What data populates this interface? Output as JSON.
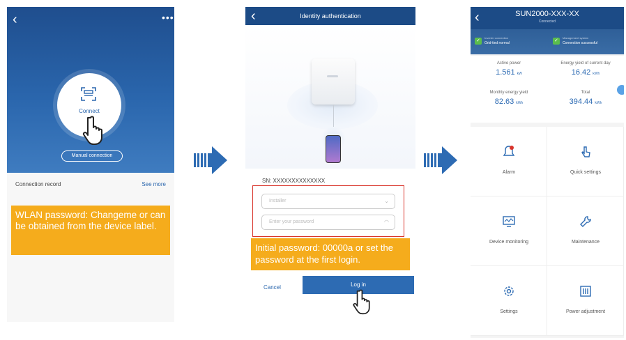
{
  "screen1": {
    "connect_label": "Connect",
    "manual_connection": "Manual connection",
    "connection_record": "Connection record",
    "see_more": "See more",
    "callout": "WLAN password: Changeme or can be obtained from the device label."
  },
  "screen2": {
    "title": "Identity authentication",
    "sn": "SN: XXXXXXXXXXXXXX",
    "user_placeholder": "Installer",
    "password_placeholder": "Enter your password",
    "callout": "Initial password: 00000a or set the password at the first login.",
    "cancel": "Cancel",
    "login": "Log in"
  },
  "screen3": {
    "device_name": "SUN2000-XXX-XX",
    "device_sub": "Connected",
    "status_left_top": "Inverter connection",
    "status_left_bottom": "Grid-tied normal",
    "status_right_top": "Management system",
    "status_right_bottom": "Connection successful",
    "active_power_label": "Active power",
    "active_power_value": "1.561",
    "active_power_unit": "kW",
    "energy_yield_label": "Energy yield of current day",
    "energy_yield_value": "16.42",
    "energy_yield_unit": "kWh",
    "monthly_yield_label": "Monthly energy yield",
    "monthly_yield_value": "82.63",
    "monthly_yield_unit": "kWh",
    "total_label": "Total",
    "total_value": "394.44",
    "total_unit": "kWh",
    "tiles": [
      "Alarm",
      "Quick settings",
      "Device monitoring",
      "Maintenance",
      "Settings",
      "Power adjustment"
    ]
  },
  "colors": {
    "brand_blue": "#1c4b86",
    "accent_blue": "#2d6bb3",
    "callout_orange": "#f5ac1c",
    "highlight_red": "#d9342b"
  }
}
